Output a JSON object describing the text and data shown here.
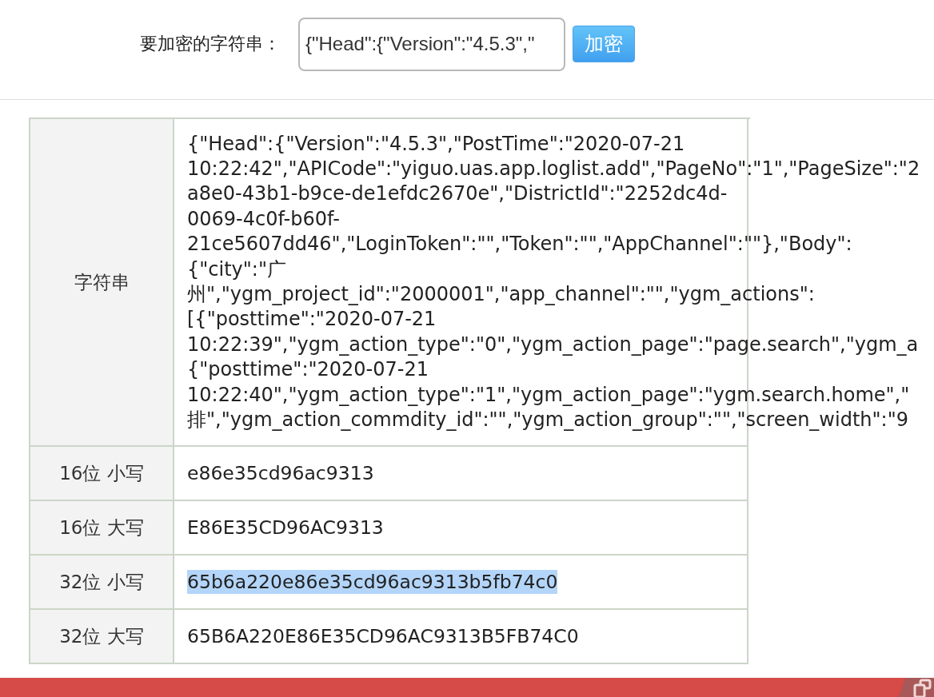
{
  "form": {
    "label": "要加密的字符串：",
    "value": "{\"Head\":{\"Version\":\"4.5.3\",\"",
    "button": "加密"
  },
  "table": {
    "source_row": {
      "label": "字符串",
      "lines": [
        "{\"Head\":{\"Version\":\"4.5.3\",\"PostTime\":\"2020-07-21",
        "10:22:42\",\"APICode\":\"yiguo.uas.app.loglist.add\",\"PageNo\":\"1\",\"PageSize\":\"2",
        "a8e0-43b1-b9ce-de1efdc2670e\",\"DistrictId\":\"2252dc4d-",
        "0069-4c0f-b60f-",
        "21ce5607dd46\",\"LoginToken\":\"\",\"Token\":\"\",\"AppChannel\":\"\"},\"Body\":",
        "{\"city\":\"广",
        "州\",\"ygm_project_id\":\"2000001\",\"app_channel\":\"\",\"ygm_actions\":",
        "[{\"posttime\":\"2020-07-21",
        "10:22:39\",\"ygm_action_type\":\"0\",\"ygm_action_page\":\"page.search\",\"ygm_a",
        "{\"posttime\":\"2020-07-21",
        "10:22:40\",\"ygm_action_type\":\"1\",\"ygm_action_page\":\"ygm.search.home\",\"",
        "排\",\"ygm_action_commdity_id\":\"\",\"ygm_action_group\":\"\",\"screen_width\":\"9"
      ]
    },
    "results": [
      {
        "label": "16位 小写",
        "value": "e86e35cd96ac9313",
        "highlighted": false
      },
      {
        "label": "16位 大写",
        "value": "E86E35CD96AC9313",
        "highlighted": false
      },
      {
        "label": "32位 小写",
        "value": "65b6a220e86e35cd96ac9313b5fb74c0",
        "highlighted": true
      },
      {
        "label": "32位 大写",
        "value": "65B6A220E86E35CD96AC9313B5FB74C0",
        "highlighted": false
      }
    ]
  }
}
